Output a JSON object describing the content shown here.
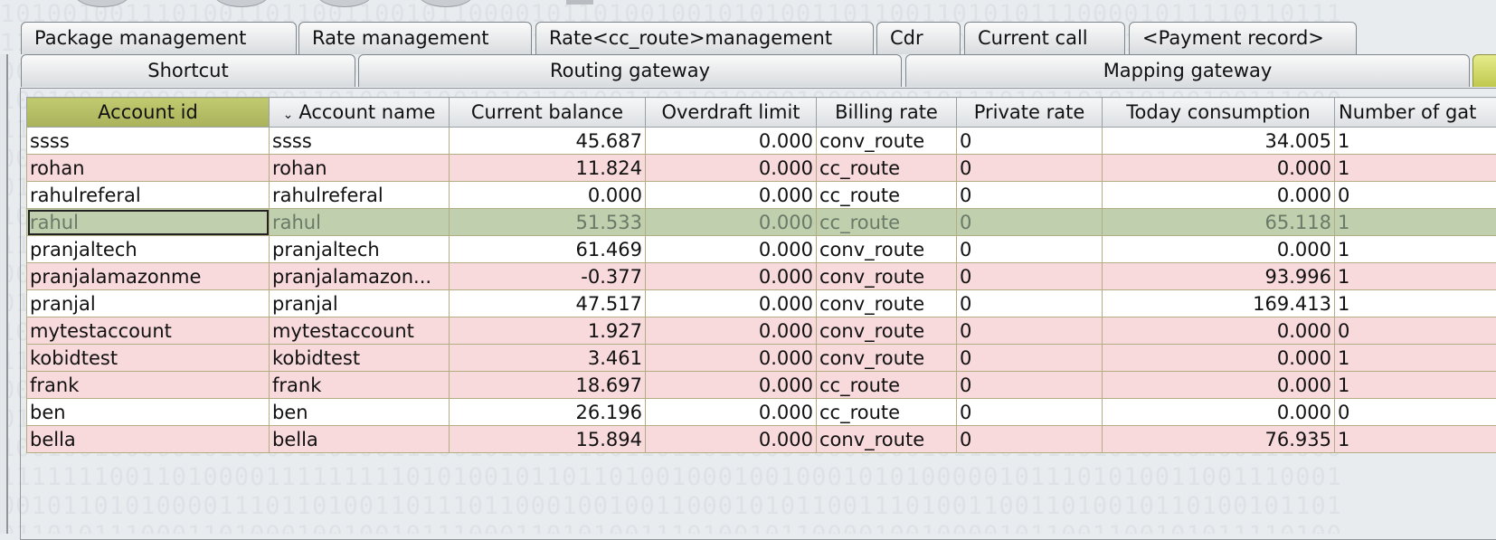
{
  "tabs_row1": [
    {
      "label": "Package management"
    },
    {
      "label": "Rate management"
    },
    {
      "label": "Rate<cc_route>management"
    },
    {
      "label": "Cdr"
    },
    {
      "label": "Current call"
    },
    {
      "label": "<Payment record>"
    }
  ],
  "tabs_row2": [
    {
      "label": "Shortcut"
    },
    {
      "label": "Routing gateway"
    },
    {
      "label": "Mapping gateway"
    },
    {
      "label": ""
    }
  ],
  "table": {
    "columns": [
      {
        "label": "Account id"
      },
      {
        "label": "Account name"
      },
      {
        "label": "Current balance"
      },
      {
        "label": "Overdraft limit"
      },
      {
        "label": "Billing rate"
      },
      {
        "label": "Private rate"
      },
      {
        "label": "Today consumption"
      },
      {
        "label": "Number of gat"
      }
    ],
    "sort_indicator": "⌄",
    "rows": [
      {
        "id": "ssss",
        "name": "ssss",
        "balance": "45.687",
        "overdraft": "0.000",
        "billing": "conv_route",
        "private": "0",
        "today": "34.005",
        "gateways": "1"
      },
      {
        "id": "rohan",
        "name": "rohan",
        "balance": "11.824",
        "overdraft": "0.000",
        "billing": "cc_route",
        "private": "0",
        "today": "0.000",
        "gateways": "1"
      },
      {
        "id": "rahulreferal",
        "name": "rahulreferal",
        "balance": "0.000",
        "overdraft": "0.000",
        "billing": "cc_route",
        "private": "0",
        "today": "0.000",
        "gateways": "0"
      },
      {
        "id": "rahul",
        "name": "rahul",
        "balance": "51.533",
        "overdraft": "0.000",
        "billing": "cc_route",
        "private": "0",
        "today": "65.118",
        "gateways": "1"
      },
      {
        "id": "pranjaltech",
        "name": "pranjaltech",
        "balance": "61.469",
        "overdraft": "0.000",
        "billing": "conv_route",
        "private": "0",
        "today": "0.000",
        "gateways": "1"
      },
      {
        "id": "pranjalamazonme",
        "name": "pranjalamazon...",
        "balance": "-0.377",
        "overdraft": "0.000",
        "billing": "conv_route",
        "private": "0",
        "today": "93.996",
        "gateways": "1"
      },
      {
        "id": "pranjal",
        "name": "pranjal",
        "balance": "47.517",
        "overdraft": "0.000",
        "billing": "conv_route",
        "private": "0",
        "today": "169.413",
        "gateways": "1"
      },
      {
        "id": "mytestaccount",
        "name": "mytestaccount",
        "balance": "1.927",
        "overdraft": "0.000",
        "billing": "conv_route",
        "private": "0",
        "today": "0.000",
        "gateways": "0"
      },
      {
        "id": "kobidtest",
        "name": "kobidtest",
        "balance": "3.461",
        "overdraft": "0.000",
        "billing": "conv_route",
        "private": "0",
        "today": "0.000",
        "gateways": "1"
      },
      {
        "id": "frank",
        "name": "frank",
        "balance": "18.697",
        "overdraft": "0.000",
        "billing": "cc_route",
        "private": "0",
        "today": "0.000",
        "gateways": "1"
      },
      {
        "id": "ben",
        "name": "ben",
        "balance": "26.196",
        "overdraft": "0.000",
        "billing": "cc_route",
        "private": "0",
        "today": "0.000",
        "gateways": "0"
      },
      {
        "id": "bella",
        "name": "bella",
        "balance": "15.894",
        "overdraft": "0.000",
        "billing": "conv_route",
        "private": "0",
        "today": "76.935",
        "gateways": "1"
      }
    ]
  },
  "colors": {
    "sorted_header": "#b6bf62",
    "row_alt": "#f8d9dc",
    "row_selected": "#c0cfad",
    "active_tab": "#cfd764"
  }
}
